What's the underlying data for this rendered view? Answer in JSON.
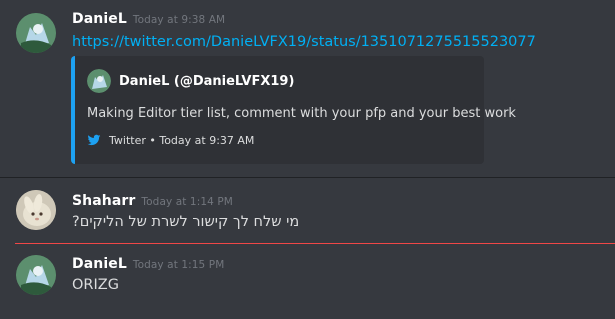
{
  "messages": [
    {
      "author": "DanieL",
      "timestamp": "Today at 9:38 AM",
      "link": "https://twitter.com/DanieLVFX19/status/1351071275515523077",
      "embed": {
        "author": "DanieL (@DanieLVFX19)",
        "description": "Making Editor tier list, comment with your pfp and your best work",
        "footer": "Twitter • Today at 9:37 AM",
        "accent_color": "#1da1f2",
        "footer_icon": "twitter-icon"
      }
    },
    {
      "author": "Shaharr",
      "timestamp": "Today at 1:14 PM",
      "text": "מי שלח לך קישור לשרת של הליקים?"
    },
    {
      "author": "DanieL",
      "timestamp": "Today at 1:15 PM",
      "text": "ORIZG"
    }
  ],
  "colors": {
    "background": "#36393f",
    "embed_background": "#2f3136",
    "link": "#00b0f4",
    "new_messages_line": "#f04747",
    "timestamp": "#72767d"
  }
}
